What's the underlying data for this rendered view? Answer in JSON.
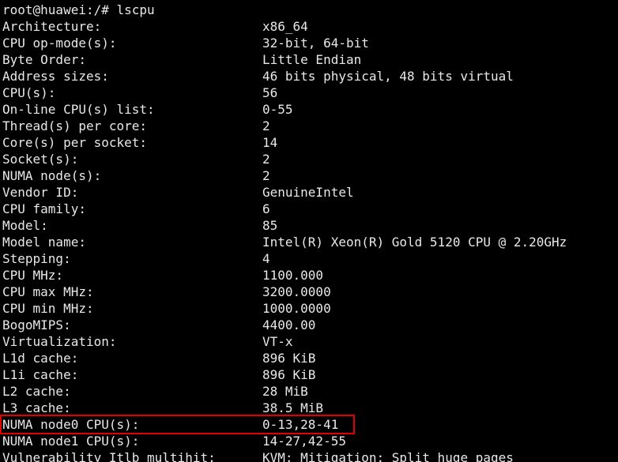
{
  "terminal": {
    "prompt_line": "root@huawei:/# lscpu",
    "rows": [
      {
        "key": "Architecture:",
        "value": "x86_64"
      },
      {
        "key": "CPU op-mode(s):",
        "value": "32-bit, 64-bit"
      },
      {
        "key": "Byte Order:",
        "value": "Little Endian"
      },
      {
        "key": "Address sizes:",
        "value": "46 bits physical, 48 bits virtual"
      },
      {
        "key": "CPU(s):",
        "value": "56"
      },
      {
        "key": "On-line CPU(s) list:",
        "value": "0-55"
      },
      {
        "key": "Thread(s) per core:",
        "value": "2"
      },
      {
        "key": "Core(s) per socket:",
        "value": "14"
      },
      {
        "key": "Socket(s):",
        "value": "2"
      },
      {
        "key": "NUMA node(s):",
        "value": "2"
      },
      {
        "key": "Vendor ID:",
        "value": "GenuineIntel"
      },
      {
        "key": "CPU family:",
        "value": "6"
      },
      {
        "key": "Model:",
        "value": "85"
      },
      {
        "key": "Model name:",
        "value": "Intel(R) Xeon(R) Gold 5120 CPU @ 2.20GHz"
      },
      {
        "key": "Stepping:",
        "value": "4"
      },
      {
        "key": "CPU MHz:",
        "value": "1100.000"
      },
      {
        "key": "CPU max MHz:",
        "value": "3200.0000"
      },
      {
        "key": "CPU min MHz:",
        "value": "1000.0000"
      },
      {
        "key": "BogoMIPS:",
        "value": "4400.00"
      },
      {
        "key": "Virtualization:",
        "value": "VT-x"
      },
      {
        "key": "L1d cache:",
        "value": "896 KiB"
      },
      {
        "key": "L1i cache:",
        "value": "896 KiB"
      },
      {
        "key": "L2 cache:",
        "value": "28 MiB"
      },
      {
        "key": "L3 cache:",
        "value": "38.5 MiB"
      },
      {
        "key": "NUMA node0 CPU(s):",
        "value": "0-13,28-41"
      },
      {
        "key": "NUMA node1 CPU(s):",
        "value": "14-27,42-55"
      },
      {
        "key": "Vulnerability Itlb multihit:",
        "value": "KVM: Mitigation: Split huge pages"
      }
    ],
    "highlighted_row_index": 24
  },
  "colors": {
    "background": "#000000",
    "text": "#e8e8e8",
    "highlight_border": "#e00000"
  }
}
